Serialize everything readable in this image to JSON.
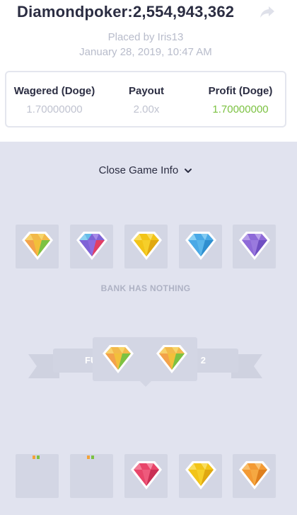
{
  "header": {
    "title": "Diamondpoker:2,554,943,362",
    "placed_by": "Placed by Iris13",
    "date": "January 28, 2019, 10:47 AM",
    "share_icon": "share-arrow-icon"
  },
  "stats": {
    "wagered_label": "Wagered (Doge)",
    "wagered_value": "1.70000000",
    "payout_label": "Payout",
    "payout_value": "2.00x",
    "profit_label": "Profit (Doge)",
    "profit_value": "1.70000000",
    "profit_color": "#7cc242"
  },
  "game": {
    "toggle_label": "Close Game Info",
    "toggle_icon": "chevron-down-icon",
    "bank_row": [
      "multi-orange-gem",
      "multi-purple-gem",
      "yellow-gem",
      "blue-gem",
      "purple-gem"
    ],
    "bank_status": "BANK HAS NOTHING",
    "banner_left": "FU",
    "banner_right": "2",
    "pair": [
      "multi-orange-gem",
      "multi-orange-gem"
    ],
    "player_row": [
      "empty-slot",
      "empty-slot",
      "red-gem",
      "yellow-gem",
      "orange-gem"
    ],
    "colors": {
      "panel_bg": "#e1e3ef",
      "slot_bg": "#d3d6e4",
      "title_text": "#2b2d42",
      "muted_text": "#b8bccb"
    }
  }
}
